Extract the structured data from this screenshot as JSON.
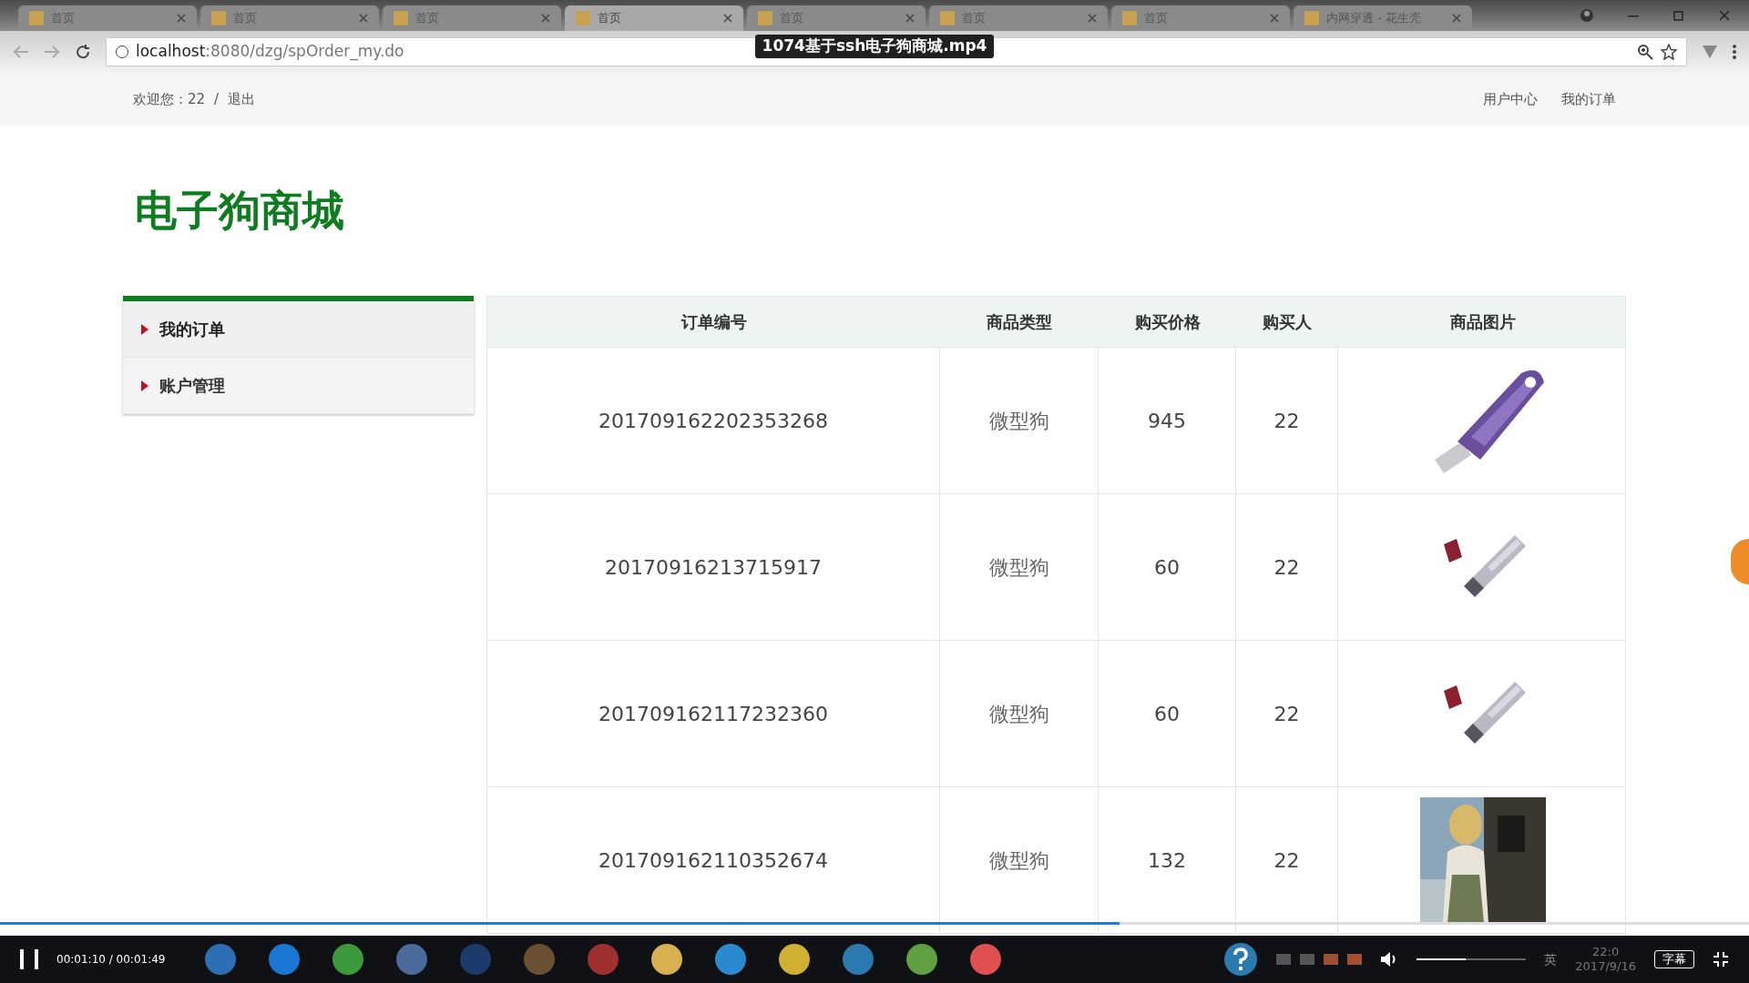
{
  "video": {
    "title": "1074基于ssh电子狗商城.mp4",
    "time": "00:01:10 / 00:01:49",
    "progress": {
      "level": 0.64
    },
    "subtitle_button": "字幕",
    "volume": {
      "level": 0.45
    }
  },
  "browser": {
    "tabs": [
      {
        "label": "首页",
        "selected": false
      },
      {
        "label": "首页",
        "selected": false
      },
      {
        "label": "首页",
        "selected": false
      },
      {
        "label": "首页",
        "selected": true
      },
      {
        "label": "首页",
        "selected": false
      },
      {
        "label": "首页",
        "selected": false
      },
      {
        "label": "首页",
        "selected": false
      },
      {
        "label": "内网穿透 - 花生壳",
        "selected": false
      }
    ],
    "url_host": "localhost",
    "url_rest": ":8080/dzg/spOrder_my.do"
  },
  "header": {
    "welcome": "欢迎您：22",
    "separator": "/",
    "logout": "退出",
    "links": [
      "用户中心",
      "我的订单"
    ]
  },
  "site_title": "电子狗商城",
  "sidebar": {
    "items": [
      {
        "label": "我的订单",
        "selected": true
      },
      {
        "label": "账户管理",
        "selected": false
      }
    ]
  },
  "table": {
    "columns": [
      "订单编号",
      "商品类型",
      "购买价格",
      "购买人",
      "商品图片"
    ],
    "rows": [
      {
        "order_no": "201709162202353268",
        "type": "微型狗",
        "price": "945",
        "buyer": "22"
      },
      {
        "order_no": "20170916213715917",
        "type": "微型狗",
        "price": "60",
        "buyer": "22"
      },
      {
        "order_no": "201709162117232360",
        "type": "微型狗",
        "price": "60",
        "buyer": "22"
      },
      {
        "order_no": "201709162110352674",
        "type": "微型狗",
        "price": "132",
        "buyer": "22"
      }
    ]
  },
  "taskbar": {
    "ime": "英",
    "clock_time": "22:0",
    "clock_date": "2017/9/16"
  }
}
